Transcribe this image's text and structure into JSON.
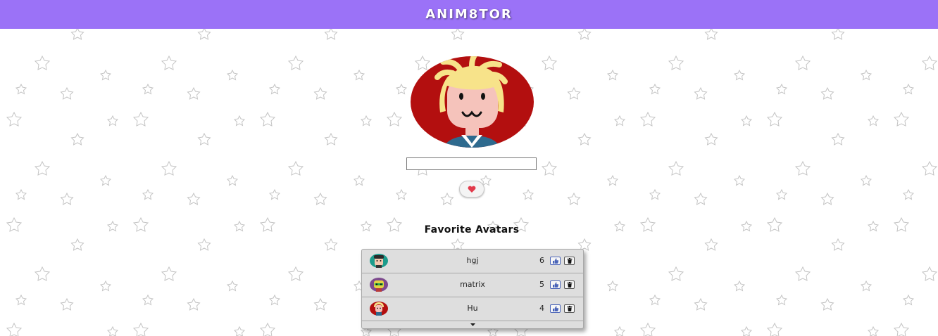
{
  "header": {
    "title": "ANIM8TOR",
    "color": "#9b72f7"
  },
  "avatar": {
    "icon": "cartoon-avatar-blonde",
    "background": "#b30f0f"
  },
  "name_input": {
    "value": "",
    "placeholder": ""
  },
  "favorite_button": {
    "icon": "heart-icon",
    "color": "#e23a4b"
  },
  "favorites": {
    "title": "Favorite Avatars",
    "items": [
      {
        "name": "hgj",
        "likes": "6",
        "avatar_icon": "avatar-teal-dark-hair"
      },
      {
        "name": "matrix",
        "likes": "5",
        "avatar_icon": "avatar-purple-yellow-face"
      },
      {
        "name": "Hu",
        "likes": "4",
        "avatar_icon": "avatar-red-blonde"
      }
    ],
    "like_icon": "thumbs-up-icon",
    "delete_icon": "trash-icon",
    "expand_icon": "caret-down-icon"
  }
}
